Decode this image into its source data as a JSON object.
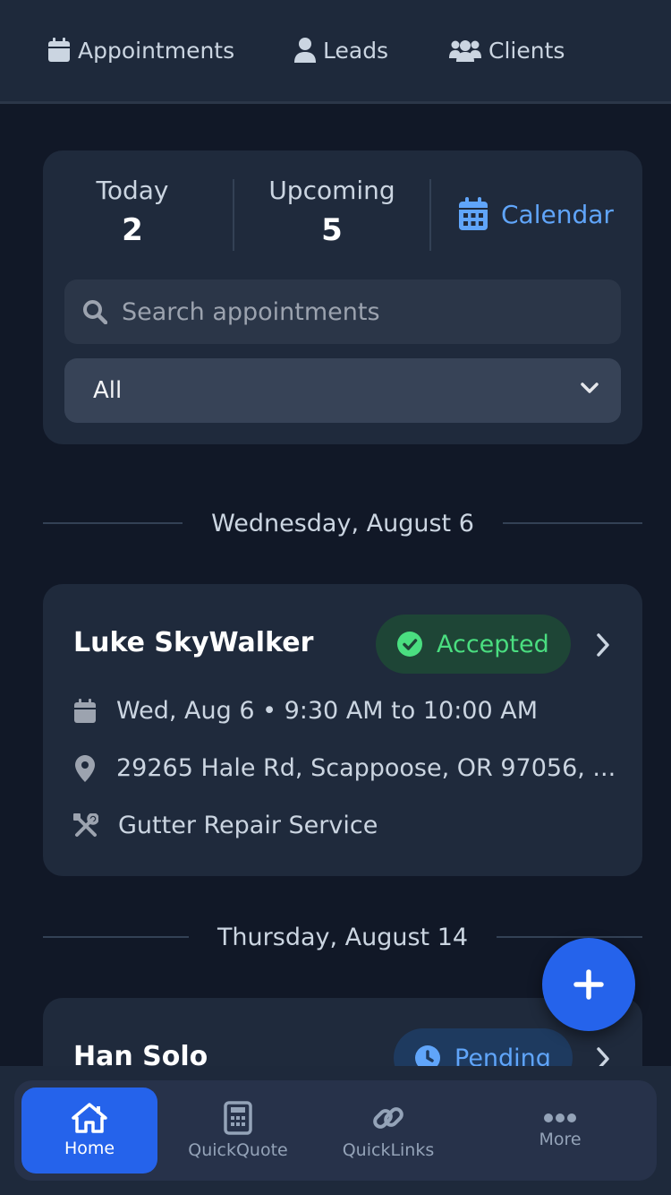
{
  "topnav": {
    "items": [
      {
        "label": "Appointments",
        "icon": "calendar-icon"
      },
      {
        "label": "Leads",
        "icon": "user-icon"
      },
      {
        "label": "Clients",
        "icon": "users-icon"
      }
    ]
  },
  "summary": {
    "today_label": "Today",
    "today_value": "2",
    "upcoming_label": "Upcoming",
    "upcoming_value": "5",
    "calendar_label": "Calendar",
    "search_placeholder": "Search appointments",
    "filter_value": "All"
  },
  "groups": [
    {
      "date": "Wednesday, August 6",
      "appointments": [
        {
          "name": "Luke SkyWalker",
          "status": "Accepted",
          "datetime": "Wed, Aug 6 • 9:30 AM to 10:00 AM",
          "address": "29265 Hale Rd, Scappoose, OR 97056, ...",
          "service": "Gutter Repair Service"
        }
      ]
    },
    {
      "date": "Thursday, August 14",
      "appointments": [
        {
          "name": "Han Solo",
          "status": "Pending"
        }
      ]
    }
  ],
  "bottom_nav": {
    "tabs": [
      {
        "label": "Home",
        "icon": "home-icon",
        "active": true
      },
      {
        "label": "QuickQuote",
        "icon": "calculator-icon"
      },
      {
        "label": "QuickLinks",
        "icon": "link-icon"
      },
      {
        "label": "More",
        "icon": "more-icon"
      }
    ]
  },
  "colors": {
    "accent": "#2563eb",
    "link": "#60a5fa",
    "accepted": "#4ade80",
    "background": "#111827",
    "card": "#1f2a3c"
  }
}
